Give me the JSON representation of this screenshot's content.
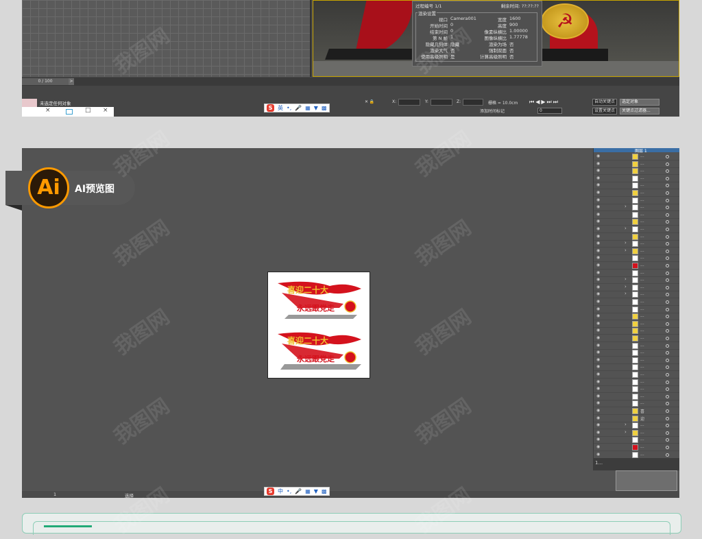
{
  "max": {
    "timeslider_label": "0 / 100",
    "timeslider_arrow": ">",
    "status_text": "未选定任何对象",
    "render_header_left": "过程编号 1/1",
    "render_header_right": "剩余时间: ??:??:??",
    "render_settings_title": "渲染设置",
    "render_left_labels": [
      "视口",
      "开始时间",
      "结束时间",
      "第 N 帧",
      "隐藏几何体",
      "渲染大气",
      "使用高级照明"
    ],
    "render_left_values": [
      "Camera001",
      "0",
      "0",
      "1",
      "隐藏",
      "否",
      "是"
    ],
    "render_right_labels": [
      "宽度",
      "高度",
      "像素纵横比",
      "图像纵横比",
      "渲染为场",
      "强制双面",
      "计算高级照明"
    ],
    "render_right_values": [
      "1600",
      "900",
      "1.00000",
      "1.77778",
      "否",
      "否",
      "否"
    ],
    "coord_x_label": "X:",
    "coord_y_label": "Y:",
    "coord_z_label": "Z:",
    "grid_label": "栅格 = 10.0cm",
    "add_time_tag": "添加时间标记",
    "auto_key": "自动关键点",
    "set_key": "设置关键点",
    "selected_object": "选定对象",
    "key_filters": "关键点过滤器...",
    "frame_value": "0",
    "taskthumb_icons": [
      "×",
      "□",
      "×"
    ]
  },
  "ime": {
    "s_icon": "S",
    "mode_top": "英",
    "mode_bottom": "中"
  },
  "ai_badge": {
    "logo": "Ai",
    "label": "AI预览图"
  },
  "ai": {
    "layer_header": "图层 1",
    "artboard_banner_1": "喜迎二十大",
    "artboard_slogan_1": "永远跟党走",
    "artboard_banner_2": "喜迎二十大",
    "artboard_slogan_2": "永远跟党走",
    "layer_names": [
      "...",
      "...",
      "...",
      "...",
      "...",
      "...",
      "...",
      "...",
      "...",
      "...",
      "...",
      "...",
      "...",
      "...",
      "...",
      "...",
      "...",
      "...",
      "...",
      "...",
      "...",
      "...",
      "...",
      "...",
      "...",
      "...",
      "...",
      "...",
      "...",
      "...",
      "...",
      "...",
      "...",
      "...",
      "...",
      "喜",
      "迎",
      "...",
      "...",
      "...",
      "...",
      "..."
    ],
    "layer_footer": "1...",
    "status_tool": "选择",
    "zoom": "1"
  },
  "watermark": "我图网",
  "colors": {
    "party_red": "#d4121d",
    "gold": "#f0c030",
    "ai_orange": "#ff9a00",
    "frame_green": "#8ccdb6"
  }
}
